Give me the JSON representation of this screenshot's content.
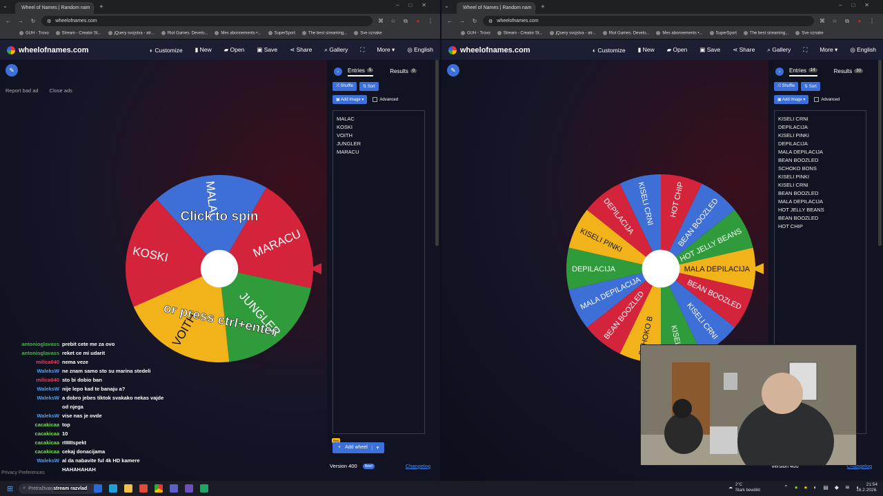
{
  "browser": {
    "tab_title": "Wheel of Names | Random nam",
    "url": "wheelofnames.com",
    "bookmarks": [
      "GUH - Trovo",
      "Stream - Creator St...",
      "jQuery svojstva - atr...",
      "Riot Games. Develo...",
      "Mes abonnements •...",
      "SuperSport",
      "The best streaming...",
      "Sve oznake"
    ]
  },
  "app": {
    "logo_text": "wheelofnames.com",
    "menu": [
      "Customize",
      "New",
      "Open",
      "Save",
      "Share",
      "Gallery",
      "More",
      "English"
    ]
  },
  "left": {
    "ad_links": {
      "report": "Report bad ad",
      "close": "Close ads"
    },
    "tabs": {
      "entries_label": "Entries",
      "entries_count": "5",
      "results_label": "Results",
      "results_count": "0"
    },
    "buttons": {
      "shuffle": "Shuffle",
      "sort": "Sort",
      "add_image": "Add image",
      "advanced": "Advanced"
    },
    "entries": [
      "MALAC",
      "KOSKI",
      "VOITH",
      "JUNGLER",
      "MARACU"
    ],
    "wheel": {
      "overlay_top": "Click to spin",
      "overlay_bottom": "or press ctrl+enter",
      "segments": [
        {
          "label": "MARACU",
          "color": "#d4243c"
        },
        {
          "label": "JUNGLER",
          "color": "#2f9b3a"
        },
        {
          "label": "VOITH",
          "color": "#f2b21a"
        },
        {
          "label": "KOSKI",
          "color": "#d4243c"
        },
        {
          "label": "MALAC",
          "color": "#3d6fd6"
        }
      ]
    },
    "add_wheel": "Add wheel",
    "beta": "Beta",
    "version": "Version 400",
    "new_badge": "New!",
    "changelog": "Changelog"
  },
  "right": {
    "tabs": {
      "entries_label": "Entries",
      "entries_count": "14",
      "results_label": "Results",
      "results_count": "30"
    },
    "buttons": {
      "shuffle": "Shuffle",
      "sort": "Sort",
      "add_image": "Add image",
      "advanced": "Advanced"
    },
    "entries": [
      "KISELI CRNI",
      "DEPILACIJA",
      "KISELI PINKI",
      "DEPILACIJA",
      "MALA DEPILACIJA",
      "BEAN BOOZLED",
      "SCHOKO BONS",
      "KISELI PINKI",
      "KISELI CRNI",
      "BEAN BOOZLED",
      "MALA DEPILACIJA",
      "HOT JELLY BEANS",
      "BEAN BOOZLED",
      "HOT CHIP"
    ],
    "wheel": {
      "segments": [
        {
          "label": "MALA DEPILACIJA",
          "color": "#f2b21a"
        },
        {
          "label": "BEAN BOOZLED",
          "color": "#d4243c"
        },
        {
          "label": "KISELI CRNI",
          "color": "#3d6fd6"
        },
        {
          "label": "KISELI P",
          "color": "#2f9b3a"
        },
        {
          "label": "SCHOKO B",
          "color": "#f2b21a"
        },
        {
          "label": "BEAN BOOZLED",
          "color": "#d4243c"
        },
        {
          "label": "MALA DEPILACIJA",
          "color": "#3d6fd6"
        },
        {
          "label": "DEPILACIJA",
          "color": "#2f9b3a"
        },
        {
          "label": "KISELI PINKI",
          "color": "#f2b21a"
        },
        {
          "label": "DEPILACIJA",
          "color": "#d4243c"
        },
        {
          "label": "KISELI CRNI",
          "color": "#3d6fd6"
        },
        {
          "label": "HOT CHIP",
          "color": "#d4243c"
        },
        {
          "label": "BEAN BOOZLED",
          "color": "#3d6fd6"
        },
        {
          "label": "HOT JELLY BEANS",
          "color": "#2f9b3a"
        }
      ]
    },
    "version": "Version 400",
    "changelog": "Changelog"
  },
  "chat": [
    {
      "user": "antonioglavass",
      "msg": "prebit cete me za ovo",
      "color": "#4caf50"
    },
    {
      "user": "antonioglavass",
      "msg": "reket ce mi udarit",
      "color": "#4caf50"
    },
    {
      "user": "milica040",
      "msg": "nema veze",
      "color": "#e04060"
    },
    {
      "user": "WaleksW",
      "msg": "ne znam samo sto su marina stedeli",
      "color": "#4aa0ff"
    },
    {
      "user": "milica040",
      "msg": "sto bi dobio ban",
      "color": "#e04060"
    },
    {
      "user": "WaleksW",
      "msg": "nije lepo kad te banaju a?",
      "color": "#4aa0ff"
    },
    {
      "user": "WaleksW",
      "msg": "a dobro jebes tiktok svakako nekas vajde od njega",
      "color": "#4aa0ff"
    },
    {
      "user": "WaleksW",
      "msg": "vise nas je ovde",
      "color": "#4aa0ff"
    },
    {
      "user": "cacakicaa",
      "msg": "top",
      "color": "#7ed957"
    },
    {
      "user": "cacakicaa",
      "msg": "10",
      "color": "#7ed957"
    },
    {
      "user": "cacakicaa",
      "msg": "rIIIIIIspekt",
      "color": "#7ed957"
    },
    {
      "user": "cacakicaa",
      "msg": "cekaj donacijama",
      "color": "#7ed957"
    },
    {
      "user": "WaleksW",
      "msg": "al da nabavite ful 4k HD kamere HAHAHAHAH",
      "color": "#4aa0ff"
    }
  ],
  "privacy": "Privacy Preferences",
  "taskbar": {
    "search_placeholder": "Pretraživanje",
    "stream_label": "stream razvlad",
    "weather": "2°C",
    "weather_desc": "Stark bewölkt",
    "time": "21:54",
    "date": "16.2.2026."
  }
}
